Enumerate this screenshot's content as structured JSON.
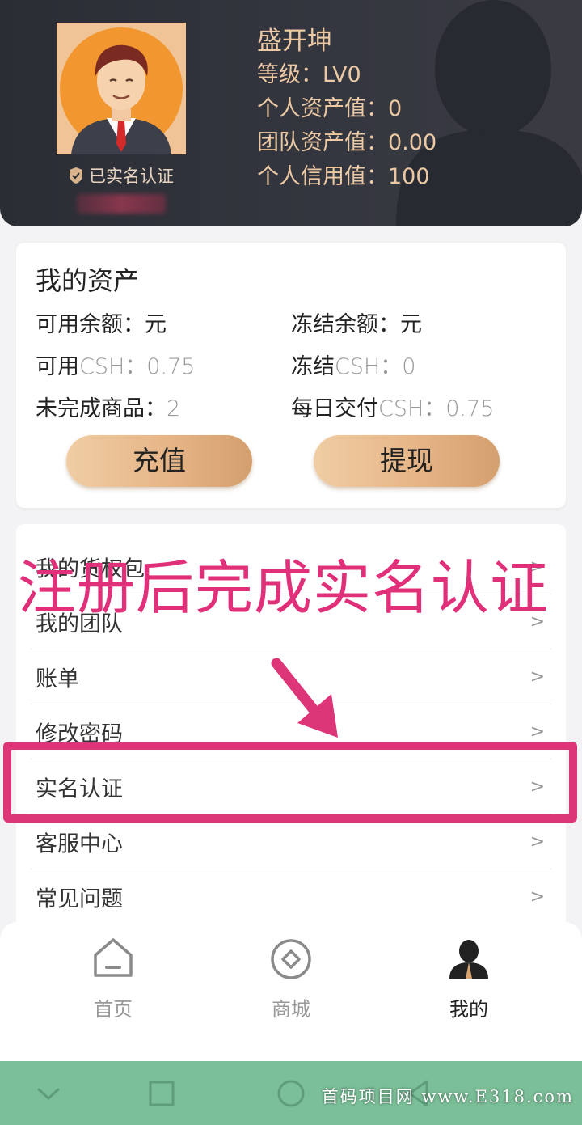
{
  "profile": {
    "name": "盛开坤",
    "level": "等级：LV0",
    "personal_assets": "个人资产值：0",
    "team_assets": "团队资产值：0.00",
    "credit": "个人信用值：100",
    "verified_label": "已实名认证"
  },
  "assets": {
    "title": "我的资产",
    "available_balance_label": "可用余额：",
    "available_balance_unit": "元",
    "frozen_balance_label": "冻结余额：",
    "frozen_balance_unit": "元",
    "available_csh_label": "可用",
    "available_csh_unit": "CSH：",
    "available_csh_value": "0.75",
    "frozen_csh_label": "冻结",
    "frozen_csh_unit": "CSH：",
    "frozen_csh_value": "0",
    "unfinished_label": "未完成商品：",
    "unfinished_value": "2",
    "daily_label": "每日交付",
    "daily_unit": "CSH：",
    "daily_value": "0.75",
    "recharge_button": "充值",
    "withdraw_button": "提现"
  },
  "menu": {
    "items": [
      {
        "label": "我的货权包",
        "chevron": ">"
      },
      {
        "label": "我的团队",
        "chevron": ">"
      },
      {
        "label": "账单",
        "chevron": ">"
      },
      {
        "label": "修改密码",
        "chevron": ">"
      },
      {
        "label": "实名认证",
        "chevron": ">"
      },
      {
        "label": "客服中心",
        "chevron": ">"
      },
      {
        "label": "常见问题",
        "chevron": ">"
      }
    ]
  },
  "annotation": {
    "text": "注册后完成实名认证",
    "color": "#e0307a"
  },
  "tabbar": {
    "tabs": [
      {
        "label": "首页",
        "icon": "home-icon"
      },
      {
        "label": "商城",
        "icon": "shop-icon"
      },
      {
        "label": "我的",
        "icon": "user-icon"
      }
    ],
    "active_index": 2
  },
  "watermark": "首码项目网 www.E318.com",
  "colors": {
    "header_bg": "#2b2d35",
    "gold_text": "#ecc9a3",
    "button_gradient_start": "#f0cda4",
    "button_gradient_end": "#d49f6e",
    "nav_bar": "#7bbf98",
    "highlight": "#dc3578"
  }
}
